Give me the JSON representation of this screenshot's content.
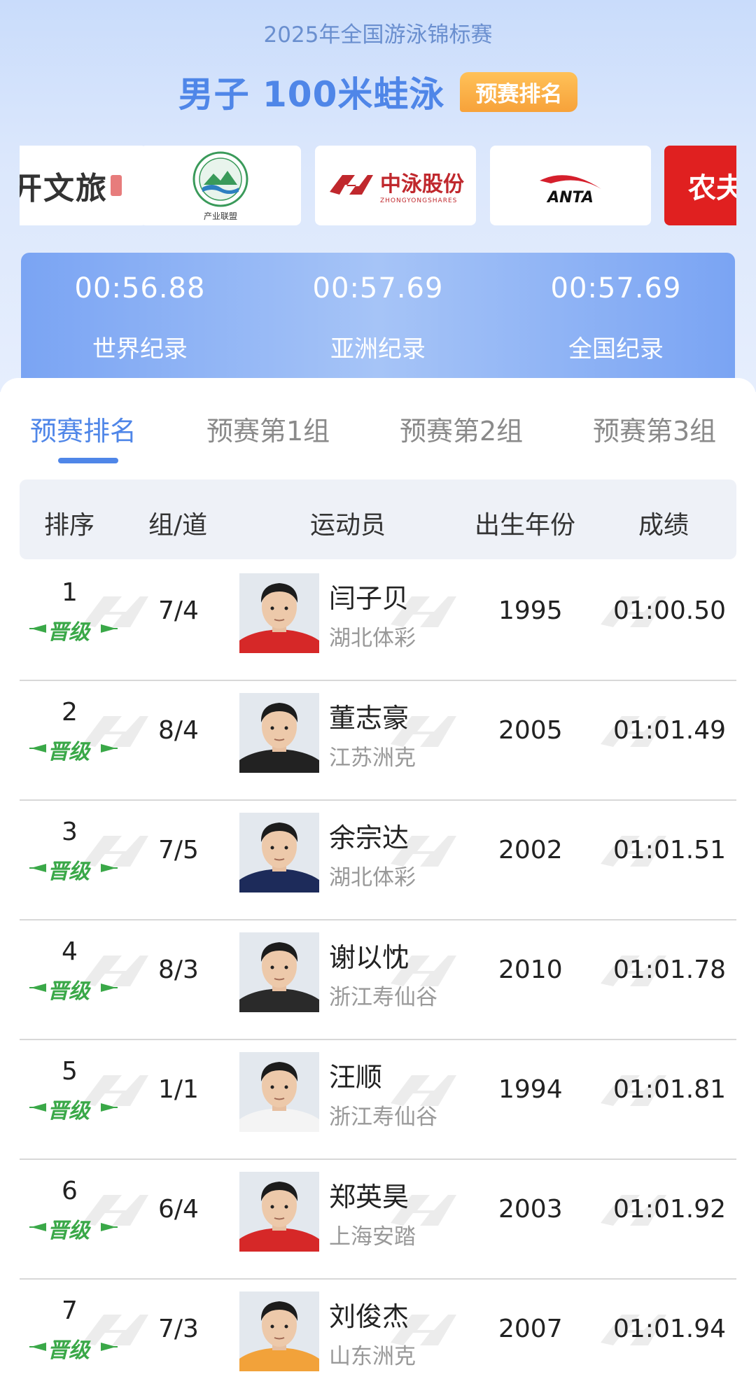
{
  "header": {
    "event_subtitle": "2025年全国游泳锦标赛",
    "event_title": "男子 100米蛙泳",
    "stage_badge": "预赛排名"
  },
  "sponsors": [
    {
      "name": "文旅",
      "label": "开文旅",
      "icon": "wenlv-logo"
    },
    {
      "name": "产业联盟",
      "label": "产业联盟",
      "icon": "alliance-seal-logo"
    },
    {
      "name": "中泳股份",
      "label": "中泳股份",
      "sub": "ZHONGYONGSHARES",
      "icon": "zhongyong-logo"
    },
    {
      "name": "ANTA",
      "label": "ANTA",
      "icon": "anta-logo"
    },
    {
      "name": "农夫",
      "label": "农夫",
      "icon": "nongfu-logo"
    }
  ],
  "records": [
    {
      "time": "00:56.88",
      "label": "世界纪录"
    },
    {
      "time": "00:57.69",
      "label": "亚洲纪录"
    },
    {
      "time": "00:57.69",
      "label": "全国纪录"
    }
  ],
  "tabs": [
    {
      "label": "预赛排名",
      "active": true
    },
    {
      "label": "预赛第1组",
      "active": false
    },
    {
      "label": "预赛第2组",
      "active": false
    },
    {
      "label": "预赛第3组",
      "active": false
    }
  ],
  "table": {
    "columns": [
      "排序",
      "组/道",
      "运动员",
      "出生年份",
      "成绩"
    ],
    "advance_label": "晋级",
    "rows": [
      {
        "rank": "1",
        "lane": "7/4",
        "name": "闫子贝",
        "team": "湖北体彩",
        "year": "1995",
        "result": "01:00.50",
        "shirt": "#d62828"
      },
      {
        "rank": "2",
        "lane": "8/4",
        "name": "董志豪",
        "team": "江苏洲克",
        "year": "2005",
        "result": "01:01.49",
        "shirt": "#222222"
      },
      {
        "rank": "3",
        "lane": "7/5",
        "name": "余宗达",
        "team": "湖北体彩",
        "year": "2002",
        "result": "01:01.51",
        "shirt": "#1d2b5a"
      },
      {
        "rank": "4",
        "lane": "8/3",
        "name": "谢以忱",
        "team": "浙江寿仙谷",
        "year": "2010",
        "result": "01:01.78",
        "shirt": "#2a2a2a"
      },
      {
        "rank": "5",
        "lane": "1/1",
        "name": "汪顺",
        "team": "浙江寿仙谷",
        "year": "1994",
        "result": "01:01.81",
        "shirt": "#f4f4f4"
      },
      {
        "rank": "6",
        "lane": "6/4",
        "name": "郑英昊",
        "team": "上海安踏",
        "year": "2003",
        "result": "01:01.92",
        "shirt": "#d62828"
      },
      {
        "rank": "7",
        "lane": "7/3",
        "name": "刘俊杰",
        "team": "山东洲克",
        "year": "2007",
        "result": "01:01.94",
        "shirt": "#f2a23a"
      }
    ]
  },
  "colors": {
    "accent": "#4f86e8",
    "badge_orange": "#f7a23a",
    "advance_green": "#3aa848"
  }
}
